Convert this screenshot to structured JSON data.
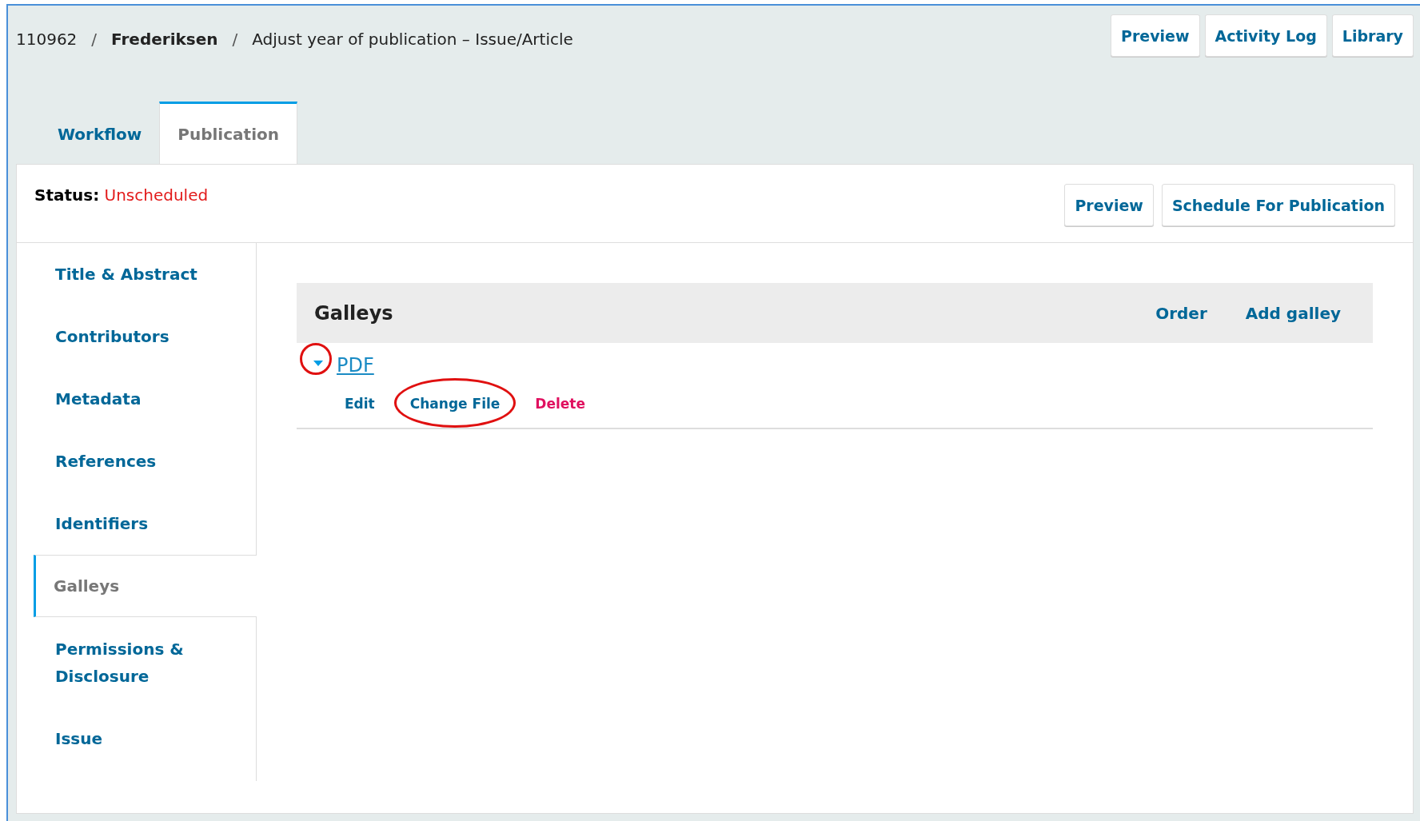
{
  "breadcrumb": {
    "id": "110962",
    "author": "Frederiksen",
    "title": "Adjust year of publication – Issue/Article",
    "separators": [
      "/",
      "/"
    ]
  },
  "header_buttons": [
    "Preview",
    "Activity Log",
    "Library"
  ],
  "tabs": [
    {
      "label": "Workflow",
      "selected": false
    },
    {
      "label": "Publication",
      "selected": true
    }
  ],
  "status": {
    "label": "Status:",
    "value": "Unscheduled"
  },
  "status_buttons": [
    "Preview",
    "Schedule For Publication"
  ],
  "sidebar": {
    "items": [
      {
        "label": "Title & Abstract",
        "selected": false
      },
      {
        "label": "Contributors",
        "selected": false
      },
      {
        "label": "Metadata",
        "selected": false
      },
      {
        "label": "References",
        "selected": false
      },
      {
        "label": "Identifiers",
        "selected": false
      },
      {
        "label": "Galleys",
        "selected": true
      },
      {
        "label": "Permissions & Disclosure",
        "selected": false
      },
      {
        "label": "Issue",
        "selected": false
      }
    ]
  },
  "galleys": {
    "title": "Galleys",
    "actions": [
      "Order",
      "Add galley"
    ],
    "rows": [
      {
        "label": "PDF",
        "expanded": true,
        "expander_highlighted": true,
        "actions": [
          {
            "label": "Edit",
            "kind": "normal",
            "highlighted": false
          },
          {
            "label": "Change File",
            "kind": "normal",
            "highlighted": true
          },
          {
            "label": "Delete",
            "kind": "danger",
            "highlighted": false
          }
        ]
      }
    ]
  }
}
